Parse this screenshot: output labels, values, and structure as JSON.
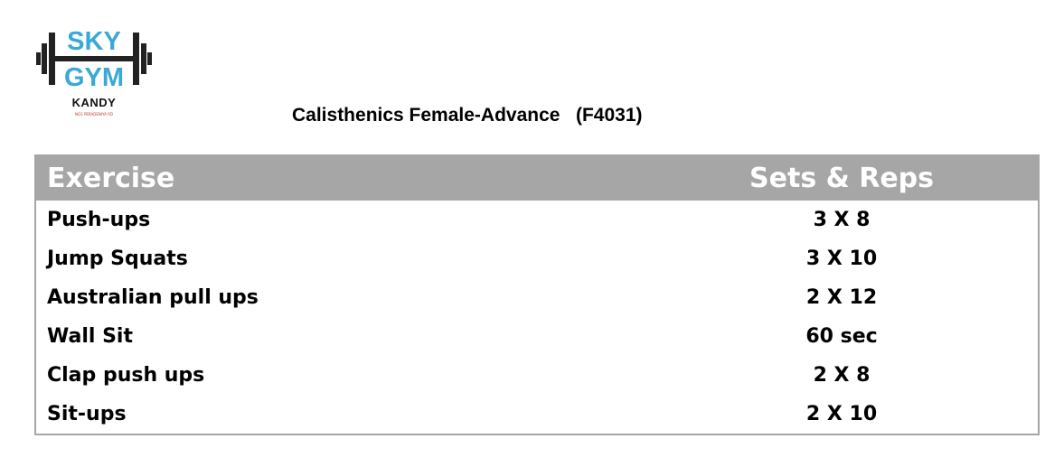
{
  "logo": {
    "line1": "SKY",
    "line2": "GYM",
    "city": "KANDY",
    "tagline": "NO1 PERADENIYA RD",
    "brand_color": "#3aa8d8"
  },
  "title": "Calisthenics Female-Advance   (F4031)",
  "table": {
    "header_color": "#a6a6a6",
    "columns": [
      "Exercise",
      "Sets & Reps"
    ],
    "rows": [
      {
        "exercise": "Push-ups",
        "sets_reps": "3 X 8"
      },
      {
        "exercise": "Jump Squats",
        "sets_reps": "3 X 10"
      },
      {
        "exercise": "Australian pull ups",
        "sets_reps": "2 X 12"
      },
      {
        "exercise": "Wall Sit",
        "sets_reps": "60 sec"
      },
      {
        "exercise": "Clap push ups",
        "sets_reps": "2 X 8"
      },
      {
        "exercise": "Sit-ups",
        "sets_reps": "2 X 10"
      }
    ]
  }
}
